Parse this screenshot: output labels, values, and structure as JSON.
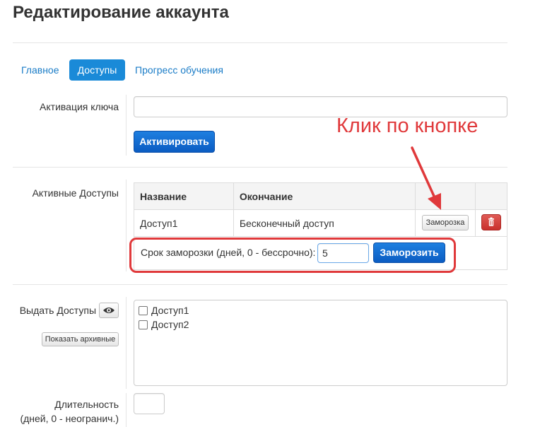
{
  "page": {
    "title": "Редактирование аккаунта"
  },
  "tabs": [
    {
      "label": "Главное",
      "active": false
    },
    {
      "label": "Доступы",
      "active": true
    },
    {
      "label": "Прогресс обучения",
      "active": false
    }
  ],
  "activation": {
    "label": "Активация ключа",
    "input_value": "",
    "button_label": "Активировать"
  },
  "active_access": {
    "label": "Активные Доступы",
    "columns": [
      "Название",
      "Окончание"
    ],
    "rows": [
      {
        "name": "Доступ1",
        "end": "Бесконечный доступ",
        "freeze_label": "Заморозка",
        "delete_icon": "trash-icon"
      }
    ],
    "freeze": {
      "label": "Срок заморозки (дней, 0 - бессрочно):",
      "input_value": "5",
      "button_label": "Заморозить"
    }
  },
  "annotation": {
    "text": "Клик по кнопке",
    "color": "#e0393b"
  },
  "grant_access": {
    "label": "Выдать Доступы",
    "eye_icon": "eye-icon",
    "show_archived_label": "Показать архивные",
    "items": [
      {
        "label": "Доступ1",
        "checked": false
      },
      {
        "label": "Доступ2",
        "checked": false
      }
    ]
  },
  "duration": {
    "label_line1": "Длительность",
    "label_line2": "(дней, 0 - неогранич.)",
    "input_value": ""
  },
  "colors": {
    "accent": "#1a8ad8",
    "link": "#1a7cc7",
    "danger": "#c9302c"
  }
}
